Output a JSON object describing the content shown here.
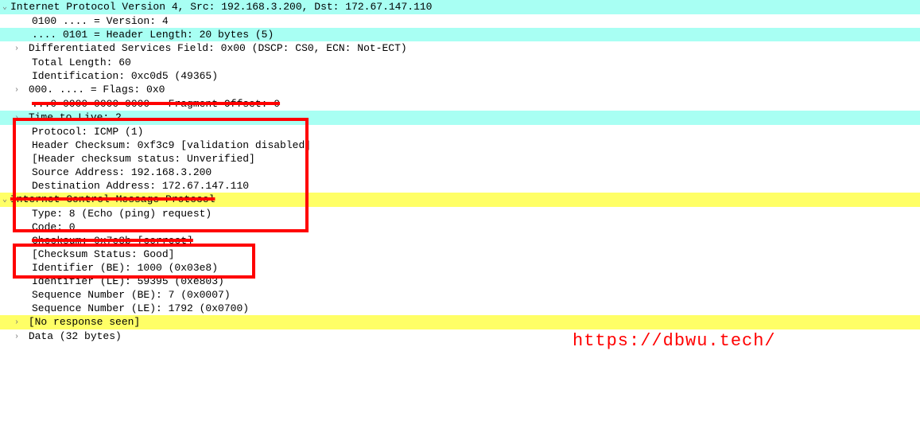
{
  "watermark": "https://dbwu.tech/",
  "ipv4": {
    "header_full": "Internet Protocol Version 4, Src: 192.168.3.200, Dst: 172.67.147.110",
    "version": "0100 .... = Version: 4",
    "header_length": ".... 0101 = Header Length: 20 bytes (5)",
    "dsf": "Differentiated Services Field: 0x00 (DSCP: CS0, ECN: Not-ECT)",
    "total_length": "Total Length: 60",
    "identification": "Identification: 0xc0d5 (49365)",
    "flags": "000. .... = Flags: 0x0",
    "fragment_offset": "...0 0000 0000 0000 = Fragment Offset: 0",
    "ttl": "Time to Live: 2",
    "protocol": "Protocol: ICMP (1)",
    "header_checksum": "Header Checksum: 0xf3c9 [validation disabled]",
    "checksum_status": "[Header checksum status: Unverified]",
    "src_addr": "Source Address: 192.168.3.200",
    "dst_addr": "Destination Address: 172.67.147.110"
  },
  "icmp": {
    "header_full": "Internet Control Message Protocol",
    "type": "Type: 8 (Echo (ping) request)",
    "code": "Code: 0",
    "checksum": "Checksum: 0x7e8b [correct]",
    "checksum_status": "[Checksum Status: Good]",
    "id_be": "Identifier (BE): 1000 (0x03e8)",
    "id_le": "Identifier (LE): 59395 (0xe803)",
    "seq_be": "Sequence Number (BE): 7 (0x0007)",
    "seq_le": "Sequence Number (LE): 1792 (0x0700)",
    "no_response": "[No response seen]",
    "data": "Data (32 bytes)"
  },
  "glyphs": {
    "expanded": "⌄",
    "collapsed": "›"
  }
}
